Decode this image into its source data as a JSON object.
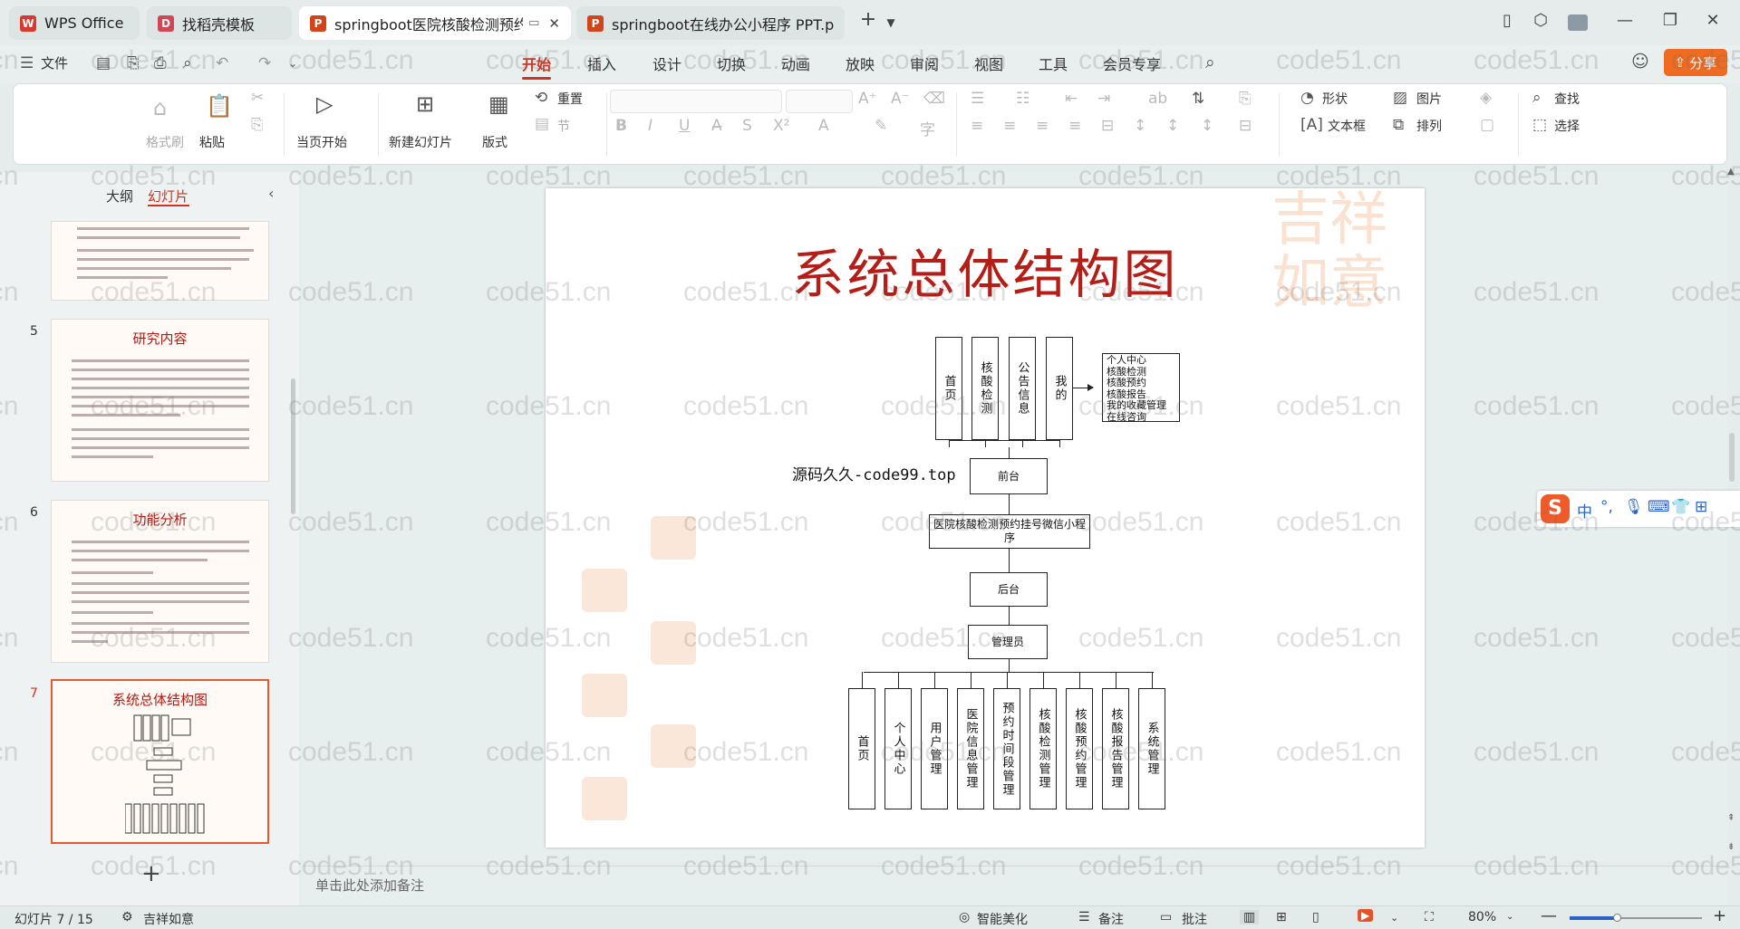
{
  "tabs": [
    {
      "label": "WPS Office",
      "icon": "wps-logo-icon",
      "icon_color": "#d63a2f"
    },
    {
      "label": "找稻壳模板",
      "icon": "docer-icon",
      "icon_color": "#d14655"
    },
    {
      "label": "springboot医院核酸检测预约",
      "icon": "ppt-file-icon",
      "icon_color": "#d0451b"
    },
    {
      "label": "springboot在线办公小程序 PPT.ppt",
      "icon": "ppt-file-icon",
      "icon_color": "#d0451b"
    }
  ],
  "menu": {
    "file_label": "文件",
    "items": [
      "开始",
      "插入",
      "设计",
      "切换",
      "动画",
      "放映",
      "审阅",
      "视图",
      "工具",
      "会员专享"
    ],
    "active": "开始",
    "share_label": "分享"
  },
  "ribbon": {
    "format_painter": "格式刷",
    "paste": "粘贴",
    "start_from_current": "当页开始",
    "new_slide": "新建幻灯片",
    "layout": "版式",
    "reset": "重置",
    "section": "节",
    "shape": "形状",
    "picture": "图片",
    "find": "查找",
    "textbox": "文本框",
    "arrange": "排列",
    "select": "选择"
  },
  "panel": {
    "outline_tab": "大纲",
    "slides_tab": "幻灯片",
    "slides": [
      {
        "number": "5",
        "title": "研究内容"
      },
      {
        "number": "6",
        "title": "功能分析"
      },
      {
        "number": "7",
        "title": "系统总体结构图",
        "selected": true
      }
    ],
    "add_slide": "+"
  },
  "slide": {
    "title": "系统总体结构图",
    "top_boxes": [
      "首页",
      "核酸检测",
      "公告信息",
      "我的"
    ],
    "my_detail": "个人中心\n核酸检测\n核酸预约\n核酸报告\n我的收藏管理\n在线咨询",
    "frontend": "前台",
    "app": "医院核酸检测预约挂号微信小程序",
    "backend": "后台",
    "admin": "管理员",
    "bottom_boxes": [
      "首页",
      "个人中心",
      "用户管理",
      "医院信息管理",
      "预约时间段管理",
      "核酸检测管理",
      "核酸预约管理",
      "核酸报告管理",
      "系统管理"
    ],
    "source_label": "源码久久-code99.top"
  },
  "notes_placeholder": "单击此处添加备注",
  "status": {
    "slide_counter": "幻灯片 7 / 15",
    "theme": "吉祥如意",
    "smart_beautify": "智能美化",
    "notes": "备注",
    "comments": "批注",
    "zoom": "80%"
  },
  "watermark": "code51.cn",
  "colors": {
    "accent": "#d0331f",
    "share": "#ef6b21",
    "slide_title": "#b51d17",
    "selected_border": "#e25b2f"
  }
}
